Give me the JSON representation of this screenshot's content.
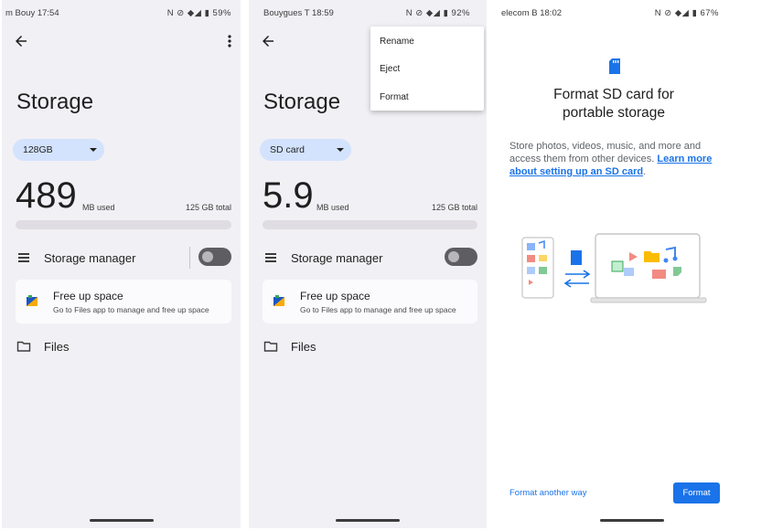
{
  "panels": [
    {
      "status": {
        "left": "m      Bouy  17:54",
        "right": "N  ⊘  ◆◢ ▮ 59%"
      },
      "title": "Storage",
      "storage_selector": "128GB",
      "used_value": "489",
      "used_unit": "MB used",
      "total": "125 GB total",
      "storage_manager_label": "Storage manager",
      "free_up_title": "Free up space",
      "free_up_subtitle": "Go to Files app to manage and free up space",
      "files_label": "Files"
    },
    {
      "status": {
        "left": "Bouygues T  18:59",
        "right": "N  ⊘  ◆◢ ▮ 92%"
      },
      "title": "Storage",
      "storage_selector": "SD card",
      "used_value": "5.9",
      "used_unit": "MB used",
      "total": "125 GB total",
      "storage_manager_label": "Storage manager",
      "free_up_title": "Free up space",
      "free_up_subtitle": "Go to Files app to manage and free up space",
      "files_label": "Files",
      "menu": {
        "rename": "Rename",
        "eject": "Eject",
        "format": "Format"
      }
    },
    {
      "status": {
        "left": "elecom    B  18:02",
        "right": "N  ⊘  ◆◢ ▮ 67%"
      },
      "heading": "Format SD card for portable storage",
      "description": "Store photos, videos, music, and more and access them from other devices.",
      "learn_more": "Learn more about setting up an SD card",
      "format_another_way": "Format another way",
      "format_button": "Format"
    }
  ],
  "colors": {
    "accent": "#1a73e8",
    "chip": "#d3e3fd",
    "panel_bg": "#f1f0f4"
  },
  "icons": [
    "back-arrow-icon",
    "more-vert-icon",
    "storage-list-icon",
    "folder-icon",
    "free-up-space-icon",
    "sd-card-icon"
  ]
}
